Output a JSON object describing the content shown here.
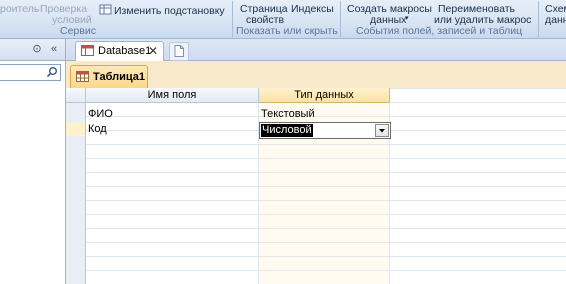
{
  "ribbon": {
    "builder_label": "роитель",
    "check_label": "Проверка",
    "check_label2": "условий",
    "change_lookup_label": "Изменить подстановку",
    "page_label": "Страница",
    "page_label2": "свойств",
    "indexes_label": "Индексы",
    "create_macros_label": "Создать макросы",
    "create_macros_label2": "данных",
    "rename_label": "Переименовать",
    "rename_label2": "или удалить макрос",
    "schema_label": "Схем",
    "schema_label2": "данн",
    "group_service": "Сервис",
    "group_show_hide": "Показать или скрыть",
    "group_events": "События полей, записей и таблиц"
  },
  "nav": {
    "menu_glyph": "⊙",
    "collapse_glyph": "«"
  },
  "tabs": {
    "database_label": "Database1",
    "close_glyph": "✕"
  },
  "object": {
    "table_label": "Таблица1"
  },
  "grid": {
    "col_name_header": "Имя поля",
    "col_type_header": "Тип данных",
    "rows": [
      {
        "name": "ФИО",
        "type": "Текстовый"
      },
      {
        "name": "Код",
        "type": "Числовой"
      }
    ]
  },
  "colors": {
    "ribbon": "#d8e4f3",
    "object_bar": "#f9e9cb",
    "header_selected": "#fbe2a3"
  }
}
